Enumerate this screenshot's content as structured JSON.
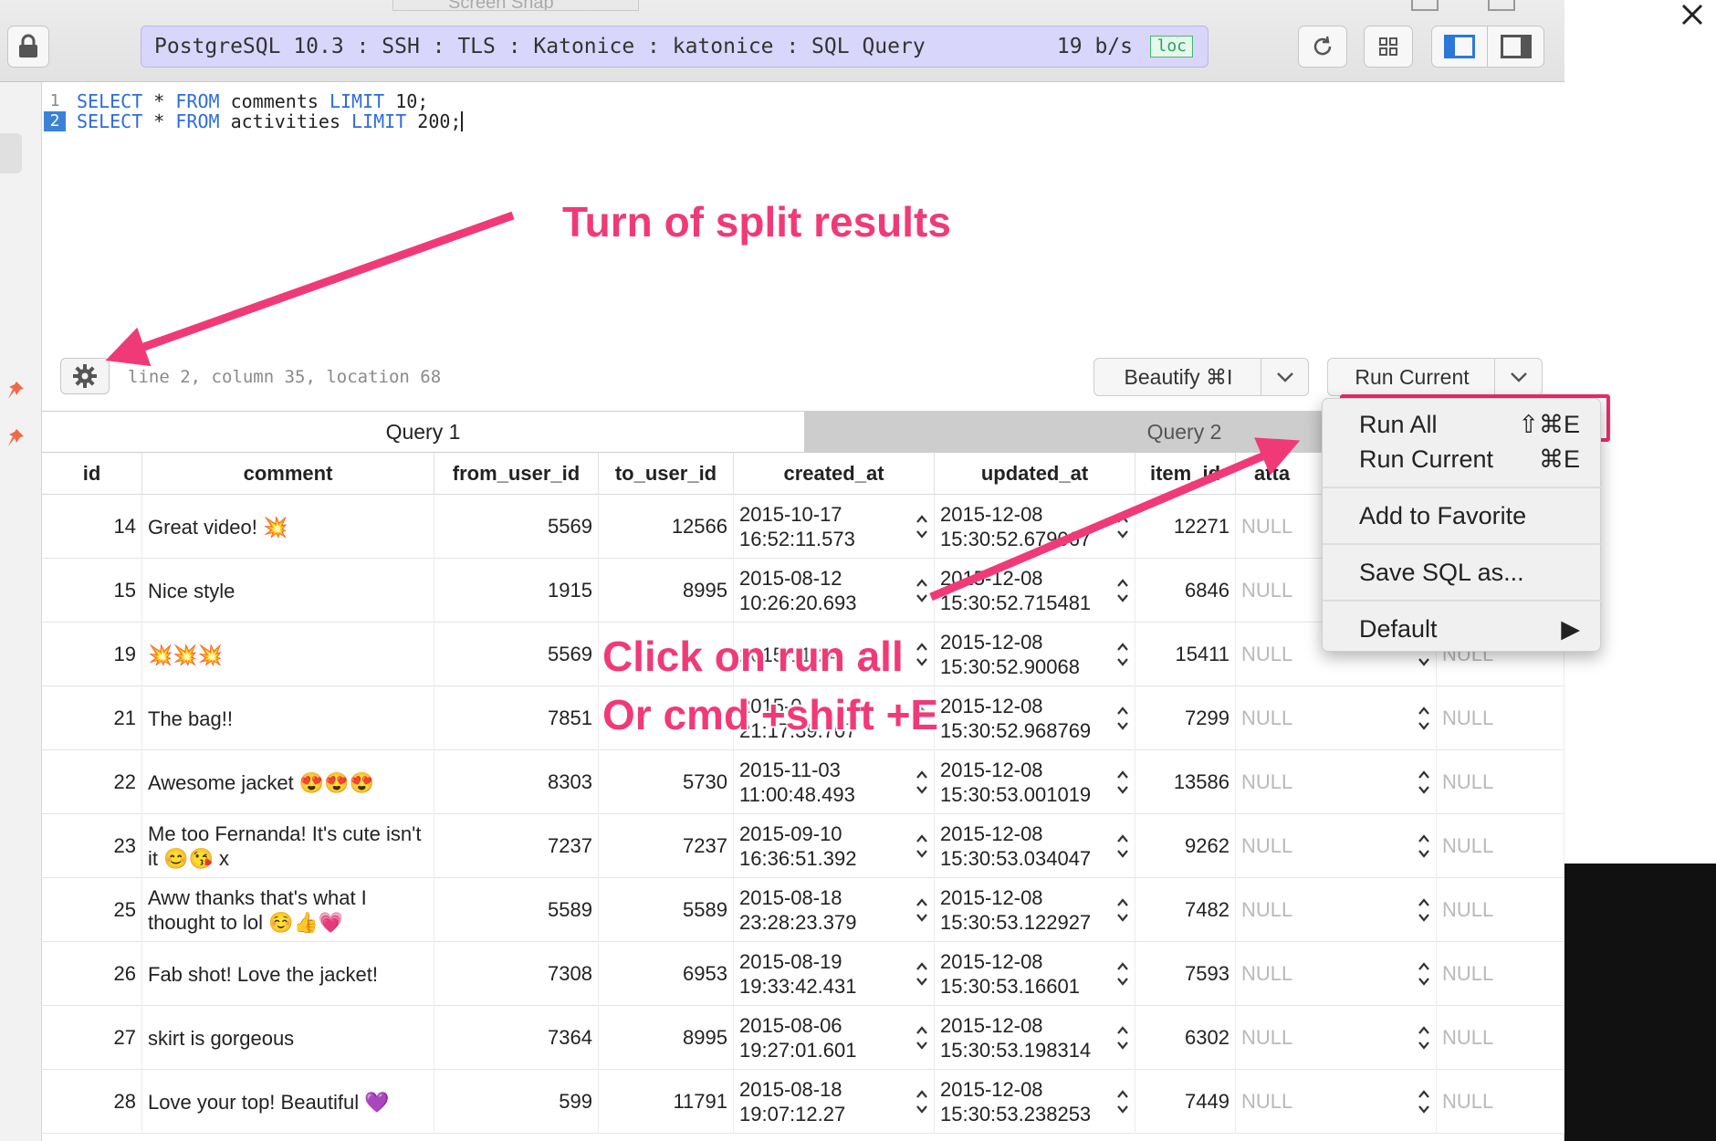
{
  "top_fragment": {
    "label": "Screen Snap"
  },
  "toolbar": {
    "connection_label": "PostgreSQL 10.3 : SSH : TLS : Katonice : katonice : SQL Query",
    "rate": "19 b/s",
    "env_badge": "loc"
  },
  "editor": {
    "lines": [
      {
        "num": "1",
        "kw1": "SELECT",
        "star": " * ",
        "kw2": "FROM",
        "table": " comments ",
        "kw3": "LIMIT",
        "rest": " 10;"
      },
      {
        "num": "2",
        "kw1": "SELECT",
        "star": " * ",
        "kw2": "FROM",
        "table": " activities ",
        "kw3": "LIMIT",
        "rest": " 200;"
      }
    ],
    "status": "line 2, column 35, location 68",
    "beautify_label": "Beautify ⌘I",
    "run_label": "Run Current"
  },
  "tabs": [
    "Query 1",
    "Query 2"
  ],
  "columns": [
    "id",
    "comment",
    "from_user_id",
    "to_user_id",
    "created_at",
    "updated_at",
    "item_id",
    "atta"
  ],
  "rows": [
    {
      "id": "14",
      "comment": "Great video! 💥",
      "from": "5569",
      "to": "12566",
      "created": "2015-10-17\n16:52:11.573",
      "updated": "2015-12-08\n15:30:52.679067",
      "item": "12271",
      "att": "NULL",
      "extra": ""
    },
    {
      "id": "15",
      "comment": "Nice style",
      "from": "1915",
      "to": "8995",
      "created": "2015-08-12\n10:26:20.693",
      "updated": "2015-12-08\n15:30:52.715481",
      "item": "6846",
      "att": "NULL",
      "extra": ""
    },
    {
      "id": "19",
      "comment": "💥💥💥",
      "from": "5569",
      "to": "",
      "created": "2015-11-24\n",
      "updated": "2015-12-08\n15:30:52.90068",
      "item": "15411",
      "att": "NULL",
      "extra": "NULL"
    },
    {
      "id": "21",
      "comment": "The bag!!",
      "from": "7851",
      "to": "",
      "created": "2015-0\n21:17:39.707",
      "updated": "2015-12-08\n15:30:52.968769",
      "item": "7299",
      "att": "NULL",
      "extra": "NULL"
    },
    {
      "id": "22",
      "comment": "Awesome jacket 😍😍😍",
      "from": "8303",
      "to": "5730",
      "created": "2015-11-03\n11:00:48.493",
      "updated": "2015-12-08\n15:30:53.001019",
      "item": "13586",
      "att": "NULL",
      "extra": "NULL"
    },
    {
      "id": "23",
      "comment": "Me too Fernanda! It's cute isn't it 😊😘 x",
      "from": "7237",
      "to": "7237",
      "created": "2015-09-10\n16:36:51.392",
      "updated": "2015-12-08\n15:30:53.034047",
      "item": "9262",
      "att": "NULL",
      "extra": "NULL"
    },
    {
      "id": "25",
      "comment": "Aww thanks that's what I thought to lol ☺️👍💗",
      "from": "5589",
      "to": "5589",
      "created": "2015-08-18\n23:28:23.379",
      "updated": "2015-12-08\n15:30:53.122927",
      "item": "7482",
      "att": "NULL",
      "extra": "NULL"
    },
    {
      "id": "26",
      "comment": "Fab shot! Love the jacket!",
      "from": "7308",
      "to": "6953",
      "created": "2015-08-19\n19:33:42.431",
      "updated": "2015-12-08\n15:30:53.16601",
      "item": "7593",
      "att": "NULL",
      "extra": "NULL"
    },
    {
      "id": "27",
      "comment": "skirt is gorgeous",
      "from": "7364",
      "to": "8995",
      "created": "2015-08-06\n19:27:01.601",
      "updated": "2015-12-08\n15:30:53.198314",
      "item": "6302",
      "att": "NULL",
      "extra": "NULL"
    },
    {
      "id": "28",
      "comment": "Love your top! Beautiful 💜",
      "from": "599",
      "to": "11791",
      "created": "2015-08-18\n19:07:12.27",
      "updated": "2015-12-08\n15:30:53.238253",
      "item": "7449",
      "att": "NULL",
      "extra": "NULL"
    }
  ],
  "menu": {
    "run_all": "Run All",
    "run_all_sc": "⇧⌘E",
    "run_current": "Run Current",
    "run_current_sc": "⌘E",
    "favorite": "Add to Favorite",
    "save_sql": "Save SQL as...",
    "default": "Default"
  },
  "annotations": {
    "split": "Turn of split results",
    "run_all_1": "Click on run all",
    "run_all_2": "Or cmd +shift +E"
  },
  "colors": {
    "annotation": "#f03a78",
    "connection_bg": "#d9d6fb",
    "keyword": "#2d6cdf",
    "env_badge": "#2aa45a"
  }
}
